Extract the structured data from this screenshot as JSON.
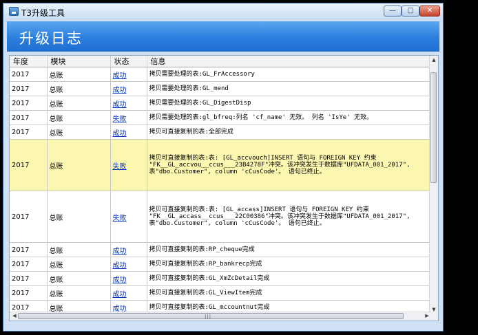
{
  "window": {
    "title": "T3升级工具",
    "controls": {
      "minimize": "—",
      "maximize": "□",
      "close": "✕"
    }
  },
  "header": {
    "title": "升级日志"
  },
  "table": {
    "columns": [
      "年度",
      "模块",
      "状态",
      "信息"
    ],
    "rows": [
      {
        "year": "2017",
        "module": "总账",
        "status": "成功",
        "info": "拷贝需要处理的表:GL_FrAccessory"
      },
      {
        "year": "2017",
        "module": "总账",
        "status": "成功",
        "info": "拷贝需要处理的表:GL_mend"
      },
      {
        "year": "2017",
        "module": "总账",
        "status": "成功",
        "info": "拷贝需要处理的表:GL_DigestDisp"
      },
      {
        "year": "2017",
        "module": "总账",
        "status": "失败",
        "info": "拷贝需要处理的表:gl_bfreq:列名 'cf_name' 无效。 列名 'IsYe' 无效。"
      },
      {
        "year": "2017",
        "module": "总账",
        "status": "成功",
        "info": "拷贝可直接复制的表:全部完成"
      },
      {
        "year": "2017",
        "module": "总账",
        "status": "失败",
        "info": "拷贝可直接复制的表:表: [GL_accvouch]INSERT 语句与 FOREIGN KEY 约束 \"FK__GL_accvou__ccus___23B4278F\"冲突。该冲突发生于数据库\"UFDATA_001_2017\", 表\"dbo.Customer\", column 'cCusCode'。 语句已终止。"
      },
      {
        "year": "2017",
        "module": "总账",
        "status": "失败",
        "info": "拷贝可直接复制的表:表: [GL_accass]INSERT 语句与 FOREIGN KEY 约束 \"FK__GL_accass__ccus___22C00386\"冲突。该冲突发生于数据库\"UFDATA_001_2017\", 表\"dbo.Customer\", column 'cCusCode'。 语句已终止。"
      },
      {
        "year": "2017",
        "module": "总账",
        "status": "成功",
        "info": "拷贝可直接复制的表:RP_cheque完成"
      },
      {
        "year": "2017",
        "module": "总账",
        "status": "成功",
        "info": "拷贝可直接复制的表:RP_bankrecp完成"
      },
      {
        "year": "2017",
        "module": "总账",
        "status": "成功",
        "info": "拷贝可直接复制的表:GL_XmZcDetail完成"
      },
      {
        "year": "2017",
        "module": "总账",
        "status": "成功",
        "info": "拷贝可直接复制的表:GL_ViewItem完成"
      },
      {
        "year": "2017",
        "module": "总账",
        "status": "成功",
        "info": "拷贝可直接复制的表:GL_mccountnut完成"
      }
    ]
  },
  "icons": {
    "app": "app-icon",
    "scroll_up": "▲",
    "scroll_down": "▼",
    "scroll_left": "◀",
    "scroll_right": "▶",
    "grip": "|||"
  },
  "colors": {
    "header_band": "#2c7fde",
    "selected_row": "#fbf6b0",
    "link": "#0033cc"
  }
}
